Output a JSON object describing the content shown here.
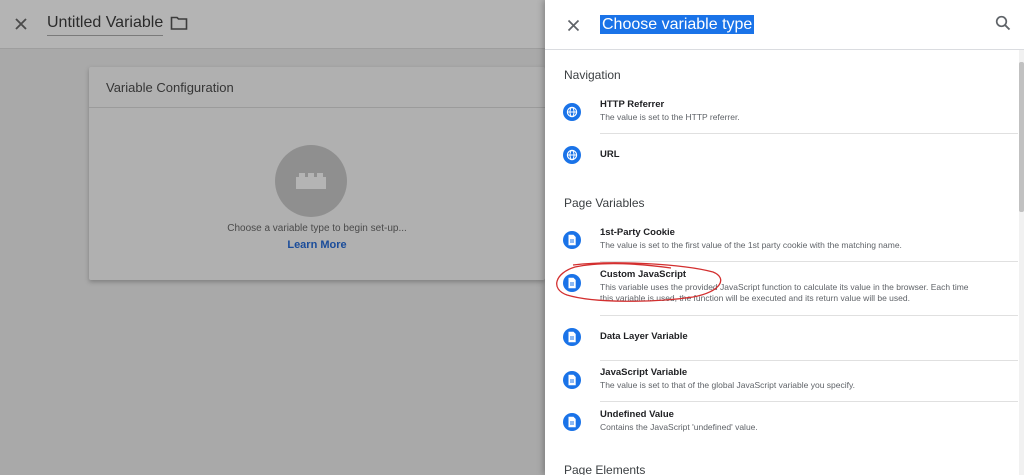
{
  "left_editor": {
    "title": "Untitled Variable",
    "card_title": "Variable Configuration",
    "hint": "Choose a variable type to begin set-up...",
    "learn_more": "Learn More"
  },
  "panel": {
    "title": "Choose variable type",
    "sections": {
      "navigation": "Navigation",
      "page_variables": "Page Variables",
      "page_elements": "Page Elements"
    },
    "items": {
      "http_referrer": {
        "name": "HTTP Referrer",
        "desc": "The value is set to the HTTP referrer."
      },
      "url": {
        "name": "URL"
      },
      "first_party_cookie": {
        "name": "1st-Party Cookie",
        "desc": "The value is set to the first value of the 1st party cookie with the matching name."
      },
      "custom_js": {
        "name": "Custom JavaScript",
        "desc1": "This variable uses the provided JavaScript function to calculate its value in the browser. Each time",
        "desc2": "this variable is used, the function will be executed and its return value will be used."
      },
      "data_layer": {
        "name": "Data Layer Variable"
      },
      "js_variable": {
        "name": "JavaScript Variable",
        "desc": "The value is set to that of the global JavaScript variable you specify."
      },
      "undefined_value": {
        "name": "Undefined Value",
        "desc": "Contains the JavaScript 'undefined' value."
      }
    }
  },
  "icons": {
    "close": "close-icon",
    "folder": "folder-icon",
    "search": "search-icon",
    "globe": "globe-icon",
    "document": "document-icon",
    "brick": "brick-icon"
  },
  "colors": {
    "accent": "#1a73e8",
    "highlight_annotation": "#d32f2f",
    "overlay": "#a9a9a9"
  }
}
